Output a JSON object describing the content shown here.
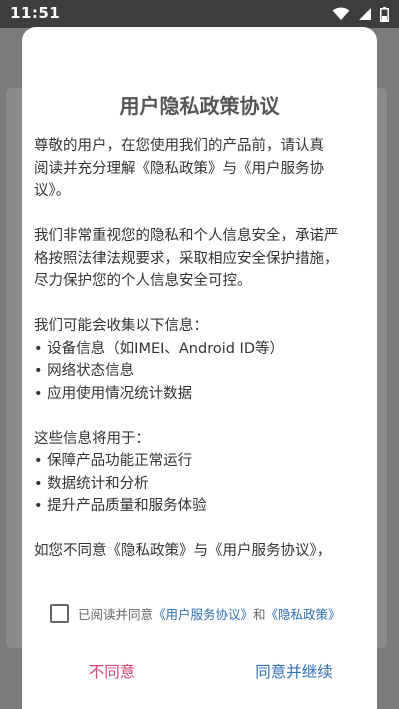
{
  "status_bar": {
    "time": "11:51",
    "icons": [
      "wifi-icon",
      "signal-icon",
      "battery-icon"
    ]
  },
  "dialog": {
    "title": "用户隐私政策协议",
    "body": {
      "intro": [
        "尊敬的用户，在您使用我们的产品前，请认真",
        "阅读并充分理解《隐私政策》与《用户服务协",
        "议》。"
      ],
      "commitment": [
        "我们非常重视您的隐私和个人信息安全，承诺严",
        "格按照法律法规要求，采取相应安全保护措施，",
        "尽力保护您的个人信息安全可控。"
      ],
      "collect_heading": "我们可能会收集以下信息：",
      "collect_items": [
        "• 设备信息（如IMEI、Android ID等）",
        "• 网络状态信息",
        "• 应用使用情况统计数据"
      ],
      "usage_heading": "这些信息将用于：",
      "usage_items": [
        "• 保障产品功能正常运行",
        "• 数据统计和分析",
        "• 提升产品质量和服务体验"
      ],
      "closing": "如您不同意《隐私政策》与《用户服务协议》，"
    },
    "agreement": {
      "checked": false,
      "prefix": "已阅读并同意",
      "terms_link": "《用户服务协议》",
      "conjunction": "和",
      "privacy_link": "《隐私政策》"
    },
    "buttons": {
      "disagree": "不同意",
      "agree": "同意并继续"
    }
  },
  "colors": {
    "disagree": "#d6456f",
    "link": "#2f6fb3",
    "title": "#555555",
    "scrim": "#7b7b7b"
  }
}
